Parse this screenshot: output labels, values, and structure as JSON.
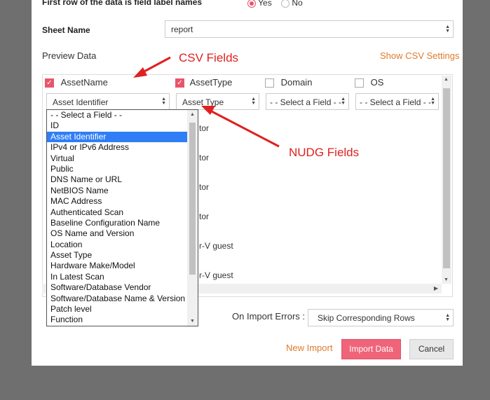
{
  "dialog": {
    "first_row_label": "First row of the data is field label names",
    "radio_yes": "Yes",
    "radio_no": "No",
    "sheet_name_label": "Sheet Name",
    "sheet_name_value": "report",
    "preview_label": "Preview Data",
    "show_csv_settings": "Show CSV Settings"
  },
  "columns": [
    {
      "name": "AssetName",
      "checked": true,
      "mapping": "Asset Identifier"
    },
    {
      "name": "AssetType",
      "checked": true,
      "mapping": "Asset Type"
    },
    {
      "name": "Domain",
      "checked": false,
      "mapping": "- - Select a Field - -"
    },
    {
      "name": "OS",
      "checked": false,
      "mapping": "- - Select a Field - -"
    }
  ],
  "preview_values": [
    "tor",
    "tor",
    "tor",
    "tor",
    "r-V guest",
    "r-V guest"
  ],
  "dropdown_options": [
    "- - Select a Field - -",
    "ID",
    "Asset Identifier",
    "IPv4 or IPv6 Address",
    "Virtual",
    "Public",
    "DNS Name or URL",
    "NetBIOS Name",
    "MAC Address",
    "Authenticated Scan",
    "Baseline Configuration Name",
    "OS Name and Version",
    "Location",
    "Asset Type",
    "Hardware Make/Model",
    "In Latest Scan",
    "Software/Database Vendor",
    "Software/Database Name & Version",
    "Patch level",
    "Function"
  ],
  "dropdown_selected": "Asset Identifier",
  "import_errors": {
    "label": "On Import Errors :",
    "value": "Skip Corresponding Rows"
  },
  "actions": {
    "new_import": "New Import",
    "import_data": "Import Data",
    "cancel": "Cancel"
  },
  "annotations": {
    "csv_fields": "CSV Fields",
    "nudg_fields": "NUDG Fields"
  },
  "colors": {
    "accent": "#e8556a",
    "link": "#e07a2b",
    "selected_option": "#2f7ef5",
    "annotation": "#e02020"
  }
}
